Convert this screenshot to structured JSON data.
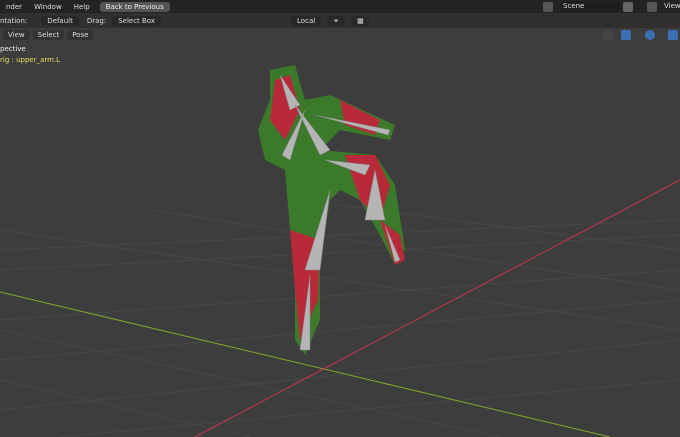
{
  "topbar": {
    "menus": [
      "nder",
      "Window",
      "Help"
    ],
    "back_button": "Back to Previous",
    "scene": "Scene",
    "view": "View"
  },
  "header": {
    "orientation_label": "ntation:",
    "orientation_value": "Default",
    "drag_label": "Drag:",
    "drag_value": "Select Box",
    "transform_space": "Local"
  },
  "viewport_menu": [
    "View",
    "Select",
    "Pose"
  ],
  "overlay": {
    "view_name": "pective",
    "active_bone": "rig : upper_arm.L"
  },
  "colors": {
    "background": "#3d3d3d",
    "x_axis": "#c23a4e",
    "y_axis": "#7fa82d",
    "active_text": "#e8e05a"
  }
}
